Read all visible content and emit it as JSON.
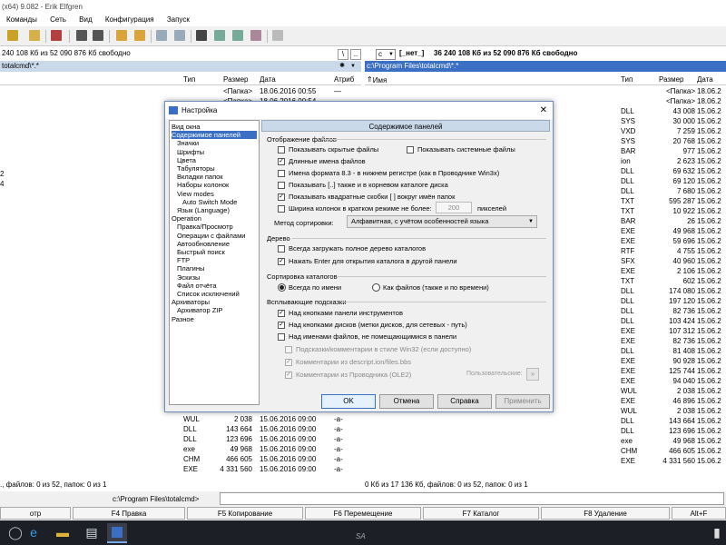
{
  "window": {
    "title": "(x64) 9.082 - Erik Elfgren"
  },
  "menu": [
    "Команды",
    "Сеть",
    "Вид",
    "Конфигурация",
    "Запуск"
  ],
  "left": {
    "drive_info": "240 108 Кб из 52 090 876 Кб свободно",
    "path": "totalcmd\\*.*",
    "cols": {
      "type": "Тип",
      "size": "Размер",
      "date": "Дата",
      "attr": "Атриб"
    },
    "rows": [
      {
        "type": "",
        "size": "<Папка>",
        "date": "18.06.2016 00:55",
        "attr": "—"
      },
      {
        "type": "",
        "size": "<Папка>",
        "date": "18.06.2016 00:54",
        "attr": "—"
      },
      {
        "type": "WUL",
        "size": "2 038",
        "date": "15.06.2016 09:00",
        "attr": "-a-"
      },
      {
        "type": "DLL",
        "size": "143 664",
        "date": "15.06.2016 09:00",
        "attr": "-a-"
      },
      {
        "type": "DLL",
        "size": "123 696",
        "date": "15.06.2016 09:00",
        "attr": "-a-"
      },
      {
        "type": "exe",
        "size": "49 968",
        "date": "15.06.2016 09:00",
        "attr": "-a-"
      },
      {
        "type": "CHM",
        "size": "466 605",
        "date": "15.06.2016 09:00",
        "attr": "-a-"
      },
      {
        "type": "EXE",
        "size": "4 331 560",
        "date": "15.06.2016 09:00",
        "attr": "-a-"
      }
    ],
    "side_digits": [
      "2",
      "4"
    ],
    "status": "., файлов: 0 из 52, папок: 0 из 1"
  },
  "right": {
    "drive_letter": "c",
    "drive_label": "[_нет_]",
    "drive_info": "36 240 108 Кб из 52 090 876 Кб свободно",
    "path": "c:\\Program Files\\totalcmd\\*.*",
    "cols": {
      "name": "Имя",
      "type": "Тип",
      "size": "Размер",
      "date": "Дата"
    },
    "rows": [
      {
        "name": "[..]",
        "type": "",
        "size": "<Папка>",
        "date": "18.06.2"
      },
      {
        "name": "[LANGUAGE]",
        "type": "",
        "size": "<Папка>",
        "date": "18.06.2"
      },
      {
        "name": "",
        "type": "DLL",
        "size": "43 008",
        "date": "15.06.2"
      },
      {
        "name": "",
        "type": "SYS",
        "size": "30 000",
        "date": "15.06.2"
      },
      {
        "name": "",
        "type": "VXD",
        "size": "7 259",
        "date": "15.06.2"
      },
      {
        "name": "",
        "type": "SYS",
        "size": "20 768",
        "date": "15.06.2"
      },
      {
        "name": "",
        "type": "BAR",
        "size": "977",
        "date": "15.06.2"
      },
      {
        "name": "",
        "type": "ion",
        "size": "2 623",
        "date": "15.06.2"
      },
      {
        "name": "",
        "type": "DLL",
        "size": "69 632",
        "date": "15.06.2"
      },
      {
        "name": "",
        "type": "DLL",
        "size": "69 120",
        "date": "15.06.2"
      },
      {
        "name": "",
        "type": "DLL",
        "size": "7 680",
        "date": "15.06.2"
      },
      {
        "name": "",
        "type": "TXT",
        "size": "595 287",
        "date": "15.06.2"
      },
      {
        "name": "",
        "type": "TXT",
        "size": "10 922",
        "date": "15.06.2"
      },
      {
        "name": "",
        "type": "BAR",
        "size": "26",
        "date": "15.06.2"
      },
      {
        "name": "",
        "type": "EXE",
        "size": "49 968",
        "date": "15.06.2"
      },
      {
        "name": "",
        "type": "EXE",
        "size": "59 696",
        "date": "15.06.2"
      },
      {
        "name": "",
        "type": "RTF",
        "size": "4 755",
        "date": "15.06.2"
      },
      {
        "name": "",
        "type": "SFX",
        "size": "40 960",
        "date": "15.06.2"
      },
      {
        "name": "",
        "type": "EXE",
        "size": "2 106",
        "date": "15.06.2"
      },
      {
        "name": "",
        "type": "TXT",
        "size": "602",
        "date": "15.06.2"
      },
      {
        "name": "",
        "type": "DLL",
        "size": "174 080",
        "date": "15.06.2"
      },
      {
        "name": "",
        "type": "DLL",
        "size": "197 120",
        "date": "15.06.2"
      },
      {
        "name": "",
        "type": "DLL",
        "size": "82 736",
        "date": "15.06.2"
      },
      {
        "name": "",
        "type": "DLL",
        "size": "103 424",
        "date": "15.06.2"
      },
      {
        "name": "",
        "type": "EXE",
        "size": "107 312",
        "date": "15.06.2"
      },
      {
        "name": "",
        "type": "EXE",
        "size": "82 736",
        "date": "15.06.2"
      },
      {
        "name": "",
        "type": "DLL",
        "size": "81 408",
        "date": "15.06.2"
      },
      {
        "name": "",
        "type": "EXE",
        "size": "90 928",
        "date": "15.06.2"
      },
      {
        "name": "",
        "type": "EXE",
        "size": "125 744",
        "date": "15.06.2"
      },
      {
        "name": "",
        "type": "EXE",
        "size": "94 040",
        "date": "15.06.2"
      },
      {
        "name": "",
        "type": "WUL",
        "size": "2 038",
        "date": "15.06.2"
      },
      {
        "name": "",
        "type": "EXE",
        "size": "46 896",
        "date": "15.06.2"
      },
      {
        "name": "TCUNINST",
        "type": "WUL",
        "size": "2 038",
        "date": "15.06.2"
      },
      {
        "name": "TCUNZL64",
        "type": "DLL",
        "size": "143 664",
        "date": "15.06.2"
      },
      {
        "name": "TCUNZLIB",
        "type": "DLL",
        "size": "123 696",
        "date": "15.06.2"
      },
      {
        "name": "TcUsbRun",
        "type": "exe",
        "size": "49 968",
        "date": "15.06.2"
      },
      {
        "name": "TOTALCMD",
        "type": "CHM",
        "size": "466 605",
        "date": "15.06.2"
      },
      {
        "name": "TOTALCMD",
        "type": "EXE",
        "size": "4 331 560",
        "date": "15.06.2"
      }
    ],
    "status": "0 Кб из 17 136 Кб, файлов: 0 из 52, папок: 0 из 1"
  },
  "cmdline": {
    "path": "c:\\Program Files\\totalcmd>"
  },
  "fkeys": [
    "отр",
    "F4 Правка",
    "F5 Копирование",
    "F6 Перемещение",
    "F7 Каталог",
    "F8 Удаление",
    "Alt+F"
  ],
  "dialog": {
    "title": "Настройка",
    "close": "✕",
    "tree": [
      {
        "label": "Вид окна",
        "indent": 0
      },
      {
        "label": "Содержимое панелей",
        "indent": 0,
        "selected": true
      },
      {
        "label": "Значки",
        "indent": 1
      },
      {
        "label": "Шрифты",
        "indent": 1
      },
      {
        "label": "Цвета",
        "indent": 1
      },
      {
        "label": "Табуляторы",
        "indent": 1
      },
      {
        "label": "Вкладки папок",
        "indent": 1
      },
      {
        "label": "Наборы колонок",
        "indent": 1
      },
      {
        "label": "View modes",
        "indent": 1
      },
      {
        "label": "Auto Switch Mode",
        "indent": 2
      },
      {
        "label": "Язык (Language)",
        "indent": 1
      },
      {
        "label": "Operation",
        "indent": 0
      },
      {
        "label": "Правка/Просмотр",
        "indent": 1
      },
      {
        "label": "Операции с файлами",
        "indent": 1
      },
      {
        "label": "Автообновление",
        "indent": 1
      },
      {
        "label": "Быстрый поиск",
        "indent": 1
      },
      {
        "label": "FTP",
        "indent": 1
      },
      {
        "label": "Плагины",
        "indent": 1
      },
      {
        "label": "Эскизы",
        "indent": 1
      },
      {
        "label": "Файл отчёта",
        "indent": 1
      },
      {
        "label": "Список исключений",
        "indent": 1
      },
      {
        "label": "Архиваторы",
        "indent": 0
      },
      {
        "label": "Архиватор ZIP",
        "indent": 1
      },
      {
        "label": "Разное",
        "indent": 0
      }
    ],
    "pane_title": "Содержимое панелей",
    "display": {
      "label": "Отображение файлов",
      "show_hidden": "Показывать скрытые файлы",
      "show_system": "Показывать системные файлы",
      "long_names": "Длинные имена файлов",
      "lowercase_83": "Имена формата 8.3 - в нижнем регистре (как в Проводнике Win3x)",
      "show_dotdot": "Показывать [..] также и в корневом каталоге диска",
      "square_brackets": "Показывать квадратные скобки [ ] вокруг имён папок",
      "col_width": "Ширина колонок в кратком режиме не более:",
      "col_width_value": "200",
      "col_width_unit": "пикселей",
      "sort_label": "Метод сортировки:",
      "sort_value": "Алфавитная, с учётом особенностей языка"
    },
    "tree_group": {
      "label": "Дерево",
      "load_full": "Всегда загружать полное дерево каталогов",
      "enter_open": "Нажать Enter для открытия каталога в другой панели"
    },
    "sort_dirs": {
      "label": "Сортировка каталогов",
      "by_name": "Всегда по имени",
      "like_files": "Как файлов (также и по времени)"
    },
    "tooltips": {
      "label": "Всплывающие подсказки",
      "toolbar_buttons": "Над кнопками панели инструментов",
      "drive_buttons": "Над кнопками дисков (метки дисков, для сетевых - путь)",
      "filenames": "Над именами файлов, не помещающимися в панели",
      "win32_style": "Подсказки/комментарии в стиле Win32 (если доступно)",
      "descript": "Комментарии из descript.ion/files.bbs",
      "explorer": "Комментарии из Проводника (OLE2)",
      "custom": "Пользовательские:",
      "custom_btn": "»"
    },
    "buttons": {
      "ok": "OK",
      "cancel": "Отмена",
      "help": "Справка",
      "apply": "Применить"
    }
  },
  "taskbar": {
    "clock": "SA"
  }
}
